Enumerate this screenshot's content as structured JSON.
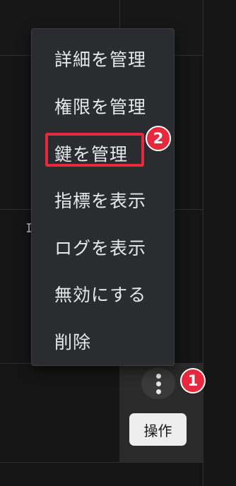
{
  "menu": {
    "items": [
      {
        "label": "詳細を管理"
      },
      {
        "label": "権限を管理"
      },
      {
        "label": "鍵を管理"
      },
      {
        "label": "指標を表示"
      },
      {
        "label": "ログを表示"
      },
      {
        "label": "無効にする"
      },
      {
        "label": "削除"
      }
    ]
  },
  "row_actions": {
    "kebab_icon": "more-vertical-icon",
    "button_label": "操作"
  },
  "annotations": {
    "step1": "1",
    "step2": "2"
  },
  "colors": {
    "highlight": "#e8283c",
    "menu_bg": "#2b2c30",
    "page_bg": "#151515"
  }
}
